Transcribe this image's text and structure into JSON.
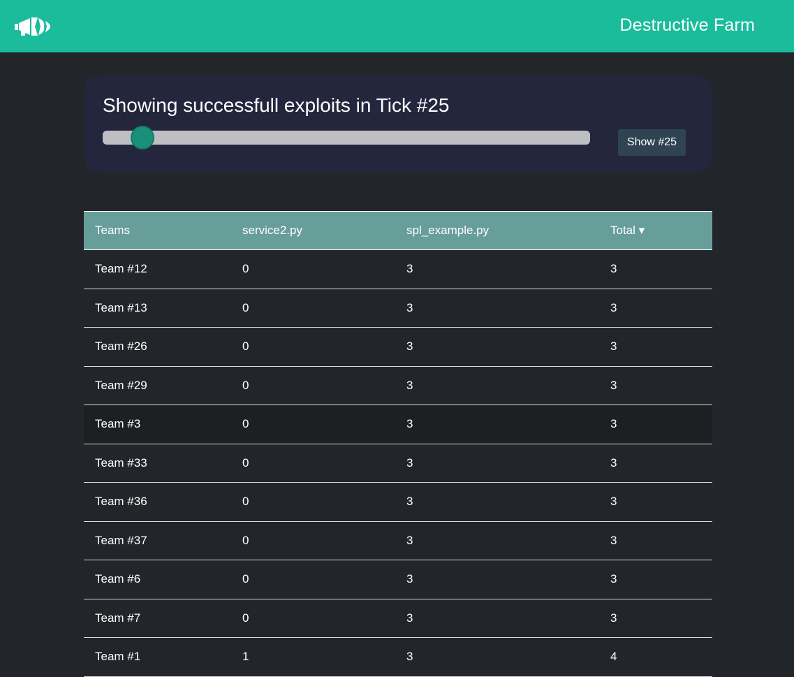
{
  "navbar": {
    "logo_icon": "megaphone-icon",
    "brand": "Destructive Farm",
    "background": "#1abc9c"
  },
  "tick_panel": {
    "title": "Showing successfull exploits in Tick #25",
    "slider_value": 25,
    "slider_fraction": 0.082,
    "button_label": "Show #25"
  },
  "table": {
    "columns": [
      "Teams",
      "service2.py",
      "spl_example.py",
      "Total ▾"
    ],
    "header_color": "#679e9a",
    "rows": [
      [
        "Team #12",
        "0",
        "3",
        "3"
      ],
      [
        "Team #13",
        "0",
        "3",
        "3"
      ],
      [
        "Team #26",
        "0",
        "3",
        "3"
      ],
      [
        "Team #29",
        "0",
        "3",
        "3"
      ],
      [
        "Team #3",
        "0",
        "3",
        "3"
      ],
      [
        "Team #33",
        "0",
        "3",
        "3"
      ],
      [
        "Team #36",
        "0",
        "3",
        "3"
      ],
      [
        "Team #37",
        "0",
        "3",
        "3"
      ],
      [
        "Team #6",
        "0",
        "3",
        "3"
      ],
      [
        "Team #7",
        "0",
        "3",
        "3"
      ],
      [
        "Team #1",
        "1",
        "3",
        "4"
      ]
    ]
  }
}
